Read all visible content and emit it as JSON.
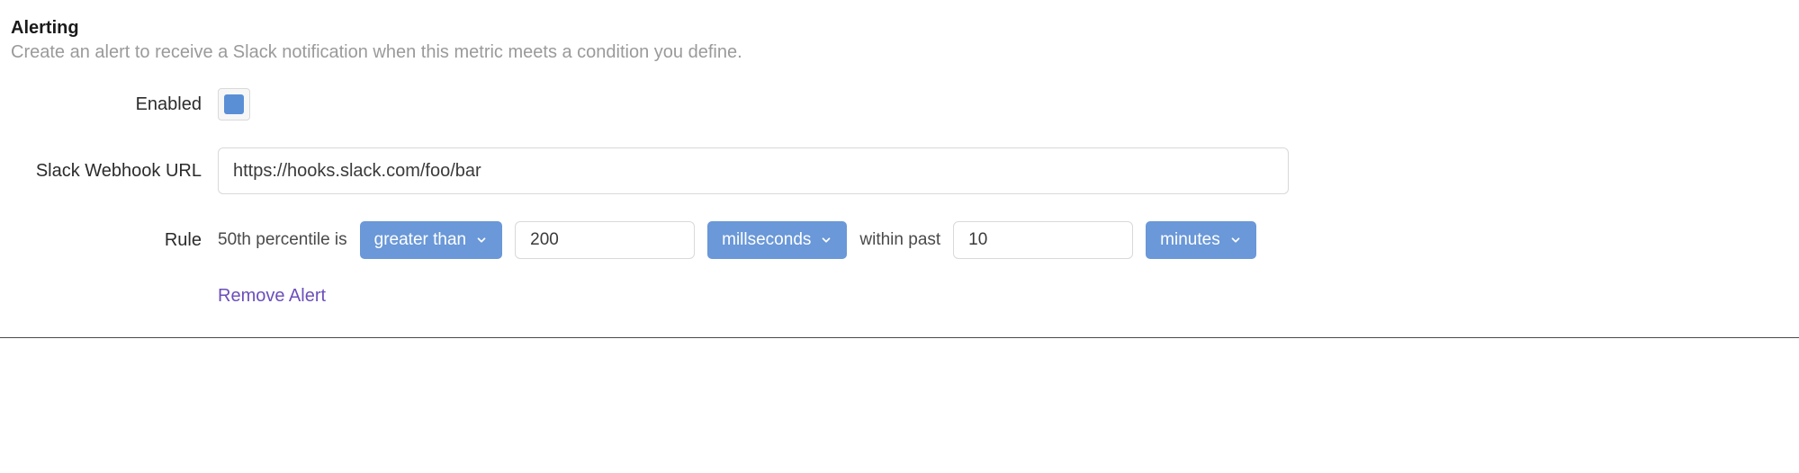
{
  "section": {
    "title": "Alerting",
    "description": "Create an alert to receive a Slack notification when this metric meets a condition you define."
  },
  "labels": {
    "enabled": "Enabled",
    "webhook": "Slack Webhook URL",
    "rule": "Rule"
  },
  "enabled": true,
  "webhook_url": "https://hooks.slack.com/foo/bar",
  "rule": {
    "prefix": "50th percentile is",
    "comparator": "greater than",
    "threshold": "200",
    "threshold_unit": "millseconds",
    "window_label": "within past",
    "window_value": "10",
    "window_unit": "minutes"
  },
  "actions": {
    "remove": "Remove Alert"
  },
  "colors": {
    "accent": "#6a98d8",
    "link": "#6b4fbb"
  }
}
